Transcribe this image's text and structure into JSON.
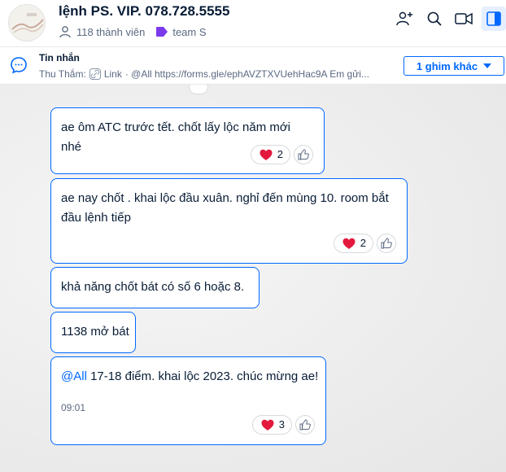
{
  "header": {
    "title": "lệnh PS. VIP.  078.728.5555",
    "members": "118 thành viên",
    "tag": "team S"
  },
  "pinned": {
    "title": "Tin nhắn",
    "sender": "Thu Thắm:",
    "link_label": "Link",
    "preview": "· @All https://forms.gle/ephAVZTXVUehHac9A Em gửi...",
    "more_button": "1 ghim khác"
  },
  "messages": [
    {
      "text": "ae ôm ATC trước tết. chốt lấy lộc năm mới nhé",
      "heart_count": "2"
    },
    {
      "text": "ae nay chốt . khai lộc đầu xuân. nghỉ đến mùng 10. room bắt đầu lệnh tiếp",
      "heart_count": "2"
    },
    {
      "text": "khả năng chốt bát có số 6 hoặc 8."
    },
    {
      "text": "1138 mở bát"
    },
    {
      "mention": "@All",
      "text": " 17-18 điểm. khai lộc 2023. chúc mừng ae!",
      "time": "09:01",
      "heart_count": "3"
    }
  ],
  "colors": {
    "accent": "#0068ff",
    "heart": "#e3183c"
  }
}
